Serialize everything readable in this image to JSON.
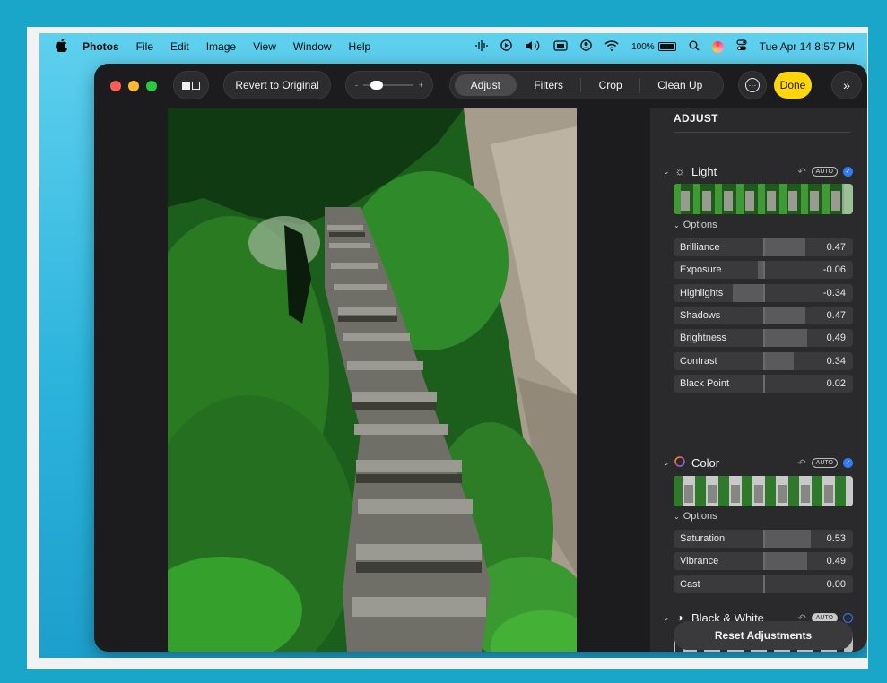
{
  "menubar": {
    "app_name": "Photos",
    "items": [
      "File",
      "Edit",
      "Image",
      "View",
      "Window",
      "Help"
    ],
    "battery": "100%",
    "clock": "Tue Apr 14  8:57 PM"
  },
  "toolbar": {
    "revert_label": "Revert to Original",
    "tabs": [
      "Adjust",
      "Filters",
      "Crop",
      "Clean Up"
    ],
    "active_tab": "Adjust",
    "done_label": "Done",
    "slider_minus": "-",
    "slider_plus": "+"
  },
  "panel": {
    "title": "ADJUST",
    "light": {
      "title": "Light",
      "auto": "AUTO",
      "options_label": "Options",
      "sliders": [
        {
          "label": "Brilliance",
          "value": "0.47",
          "level": 0.47
        },
        {
          "label": "Exposure",
          "value": "-0.06",
          "level": -0.06
        },
        {
          "label": "Highlights",
          "value": "-0.34",
          "level": -0.34
        },
        {
          "label": "Shadows",
          "value": "0.47",
          "level": 0.47
        },
        {
          "label": "Brightness",
          "value": "0.49",
          "level": 0.49
        },
        {
          "label": "Contrast",
          "value": "0.34",
          "level": 0.34
        },
        {
          "label": "Black Point",
          "value": "0.02",
          "level": 0.02
        }
      ]
    },
    "color": {
      "title": "Color",
      "auto": "AUTO",
      "options_label": "Options",
      "sliders": [
        {
          "label": "Saturation",
          "value": "0.53",
          "level": 0.53
        },
        {
          "label": "Vibrance",
          "value": "0.49",
          "level": 0.49
        },
        {
          "label": "Cast",
          "value": "0.00",
          "level": 0.0
        }
      ]
    },
    "bw": {
      "title": "Black & White",
      "auto": "AUTO"
    },
    "reset_label": "Reset Adjustments"
  },
  "colors": {
    "accent": "#2f7cf6",
    "done": "#ffd60a",
    "window_bg": "#1c1c1e",
    "panel_bg": "#2a2a2c"
  },
  "icons": [
    "apple-logo",
    "waveform",
    "play-circle",
    "volume",
    "display",
    "user-circle",
    "wifi",
    "battery",
    "search",
    "siri",
    "control-center",
    "sun",
    "color-wheel",
    "half-circle",
    "undo",
    "checkmark",
    "ellipsis",
    "chevron-right-double"
  ]
}
